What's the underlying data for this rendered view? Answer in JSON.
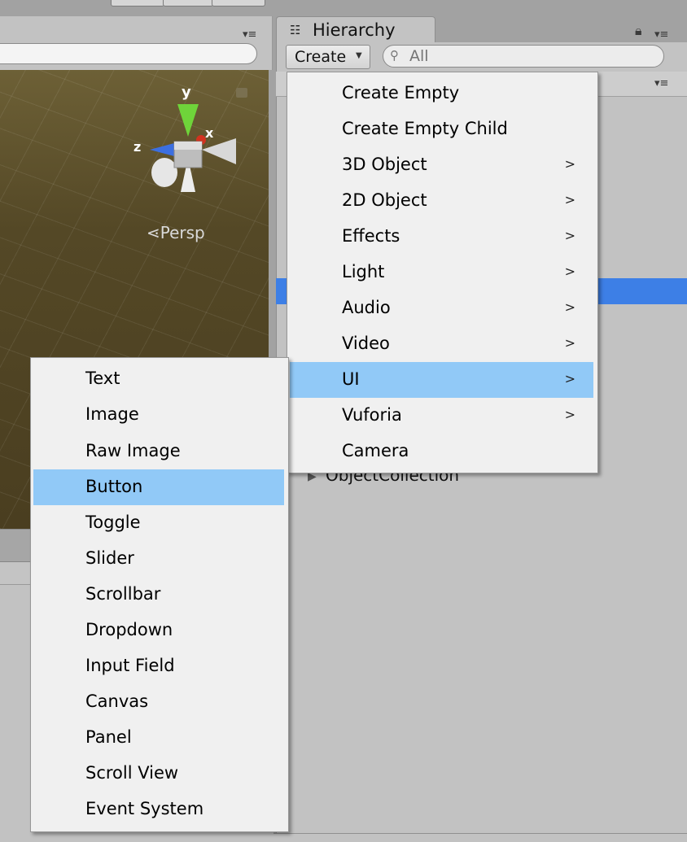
{
  "scene": {
    "gizmo": {
      "y_label": "y",
      "x_label": "x",
      "z_label": "z"
    },
    "persp_label": "⋖Persp"
  },
  "hierarchy": {
    "tab_label": "Hierarchy",
    "create_button": "Create",
    "search_placeholder": "All",
    "visible_item": "ObjectCollection"
  },
  "create_menu": {
    "items": [
      {
        "label": "Create Empty",
        "submenu": false,
        "highlighted": false
      },
      {
        "label": "Create Empty Child",
        "submenu": false,
        "highlighted": false
      },
      {
        "label": "3D Object",
        "submenu": true,
        "highlighted": false
      },
      {
        "label": "2D Object",
        "submenu": true,
        "highlighted": false
      },
      {
        "label": "Effects",
        "submenu": true,
        "highlighted": false
      },
      {
        "label": "Light",
        "submenu": true,
        "highlighted": false
      },
      {
        "label": "Audio",
        "submenu": true,
        "highlighted": false
      },
      {
        "label": "Video",
        "submenu": true,
        "highlighted": false
      },
      {
        "label": "UI",
        "submenu": true,
        "highlighted": true
      },
      {
        "label": "Vuforia",
        "submenu": true,
        "highlighted": false
      },
      {
        "label": "Camera",
        "submenu": false,
        "highlighted": false
      }
    ],
    "submenu_arrow": ">"
  },
  "ui_menu": {
    "items": [
      {
        "label": "Text",
        "highlighted": false
      },
      {
        "label": "Image",
        "highlighted": false
      },
      {
        "label": "Raw Image",
        "highlighted": false
      },
      {
        "label": "Button",
        "highlighted": true
      },
      {
        "label": "Toggle",
        "highlighted": false
      },
      {
        "label": "Slider",
        "highlighted": false
      },
      {
        "label": "Scrollbar",
        "highlighted": false
      },
      {
        "label": "Dropdown",
        "highlighted": false
      },
      {
        "label": "Input Field",
        "highlighted": false
      },
      {
        "label": "Canvas",
        "highlighted": false
      },
      {
        "label": "Panel",
        "highlighted": false
      },
      {
        "label": "Scroll View",
        "highlighted": false
      },
      {
        "label": "Event System",
        "highlighted": false
      }
    ]
  },
  "colors": {
    "menu_highlight": "#91c9f7",
    "selection_blue": "#3d7fe6",
    "gizmo_y": "#6fd43a",
    "gizmo_x": "#d2321f",
    "gizmo_z": "#3c6fe0"
  },
  "icons": {
    "panel_menu": "panel-menu-icon",
    "lock": "lock-icon",
    "hierarchy_tab": "hierarchy-list-icon",
    "search": "search-icon",
    "dropdown": "dropdown-arrow-icon",
    "submenu": "chevron-right-icon",
    "expand": "expand-triangle-icon"
  }
}
